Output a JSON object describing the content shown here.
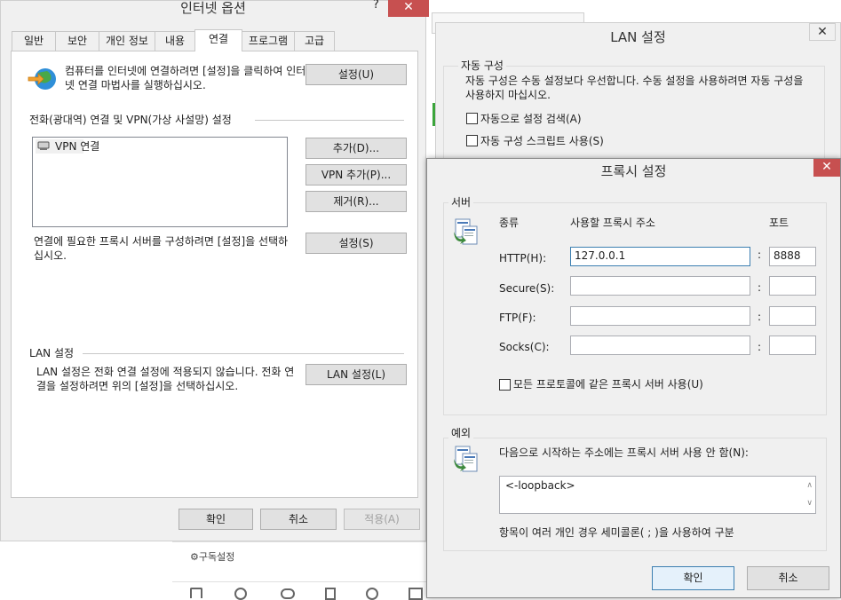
{
  "background": {
    "subscribe_label": "⚙구독설정"
  },
  "inet": {
    "title": "인터넷 옵션",
    "help": "?",
    "close": "✕",
    "tabs": [
      "일반",
      "보안",
      "개인 정보",
      "내용",
      "연결",
      "프로그램",
      "고급"
    ],
    "active_tab": "연결",
    "setup_text": "컴퓨터를 인터넷에 연결하려면 [설정]을 클릭하여 인터넷 연결 마법사를 실행하십시오.",
    "setup_button": "설정(U)",
    "dialup_heading": "전화(광대역) 연결 및 VPN(가상 사설망) 설정",
    "connections": [
      "VPN 연결"
    ],
    "add_button": "추가(D)...",
    "add_vpn_button": "VPN 추가(P)...",
    "remove_button": "제거(R)...",
    "proxy_text": "연결에 필요한 프록시 서버를 구성하려면 [설정]을 선택하십시오.",
    "settings_button": "설정(S)",
    "lan_heading": "LAN 설정",
    "lan_text": "LAN 설정은 전화 연결 설정에 적용되지 않습니다. 전화 연결을 설정하려면 위의 [설정]을 선택하십시오.",
    "lan_button": "LAN 설정(L)",
    "ok": "확인",
    "cancel": "취소",
    "apply": "적용(A)"
  },
  "lan": {
    "title": "LAN 설정",
    "close": "✕",
    "auto_group": "자동 구성",
    "auto_text": "자동 구성은 수동 설정보다 우선합니다. 수동 설정을 사용하려면 자동 구성을 사용하지 마십시오.",
    "auto_detect": "자동으로 설정 검색(A)",
    "auto_script": "자동 구성 스크립트 사용(S)"
  },
  "proxy": {
    "title": "프록시 설정",
    "close": "✕",
    "server_group": "서버",
    "col_type": "종류",
    "col_address": "사용할 프록시 주소",
    "col_port": "포트",
    "rows": [
      {
        "label": "HTTP(H):",
        "address": "127.0.0.1",
        "port": "8888"
      },
      {
        "label": "Secure(S):",
        "address": "",
        "port": ""
      },
      {
        "label": "FTP(F):",
        "address": "",
        "port": ""
      },
      {
        "label": "Socks(C):",
        "address": "",
        "port": ""
      }
    ],
    "colon": ":",
    "same_proxy": "모든 프로토콜에 같은 프록시 서버 사용(U)",
    "exceptions_group": "예외",
    "exceptions_label": "다음으로 시작하는 주소에는 프록시 서버 사용 안 함(N):",
    "exceptions_value": "<-loopback>",
    "exceptions_hint": "항목이 여러 개인 경우 세미콜론( ; )을 사용하여 구분",
    "ok": "확인",
    "cancel": "취소"
  },
  "colors": {
    "close_red": "#c75050",
    "dialog_bg": "#f0f0f0",
    "focus_blue": "#3c7fb1"
  }
}
